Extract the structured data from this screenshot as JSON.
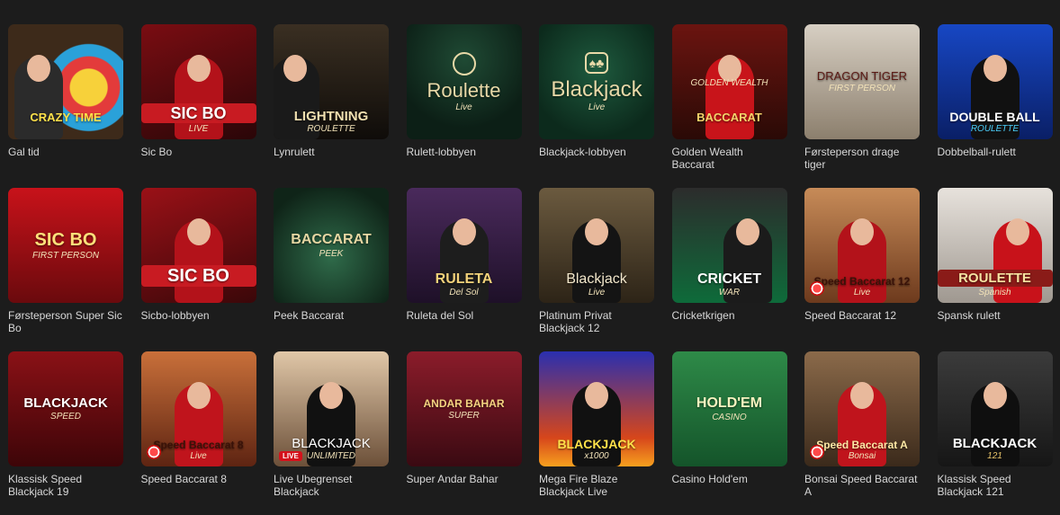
{
  "games": [
    {
      "name": "Gal tid",
      "logo": "CRAZY TIME",
      "sub": "",
      "style": "crazytime"
    },
    {
      "name": "Sic Bo",
      "logo": "SIC BO",
      "sub": "LIVE",
      "style": "sicbo"
    },
    {
      "name": "Lynrulett",
      "logo": "LIGHTNING",
      "sub": "ROULETTE",
      "style": "lightning"
    },
    {
      "name": "Rulett-lobbyen",
      "logo": "Roulette",
      "sub": "Live",
      "style": "roulette"
    },
    {
      "name": "Blackjack-lobbyen",
      "logo": "Blackjack",
      "sub": "Live",
      "style": "blackjack"
    },
    {
      "name": "Golden Wealth Baccarat",
      "logo": "BACCARAT",
      "sub": "GOLDEN WEALTH",
      "style": "golden"
    },
    {
      "name": "Førsteperson drage tiger",
      "logo": "DRAGON TIGER",
      "sub": "FIRST PERSON",
      "style": "dragon"
    },
    {
      "name": "Dobbelball-rulett",
      "logo": "DOUBLE BALL",
      "sub": "ROULETTE",
      "style": "doubleball"
    },
    {
      "name": "Førsteperson Super Sic Bo",
      "logo": "SIC BO",
      "sub": "FIRST PERSON",
      "style": "supersicbo"
    },
    {
      "name": "Sicbo-lobbyen",
      "logo": "SIC BO",
      "sub": "",
      "style": "sicbolobby"
    },
    {
      "name": "Peek Baccarat",
      "logo": "BACCARAT",
      "sub": "PEEK",
      "style": "peek"
    },
    {
      "name": "Ruleta del Sol",
      "logo": "RULETA",
      "sub": "Del Sol",
      "style": "ruleta"
    },
    {
      "name": "Platinum Privat Blackjack 12",
      "logo": "Blackjack",
      "sub": "Live",
      "style": "platinum"
    },
    {
      "name": "Cricketkrigen",
      "logo": "CRICKET",
      "sub": "WAR",
      "style": "cricket"
    },
    {
      "name": "Speed Baccarat 12",
      "logo": "Speed Baccarat 12",
      "sub": "Live",
      "style": "speedbac"
    },
    {
      "name": "Spansk rulett",
      "logo": "ROULETTE",
      "sub": "Spanish",
      "style": "spanish"
    },
    {
      "name": "Klassisk Speed Blackjack 19",
      "logo": "BLACKJACK",
      "sub": "SPEED",
      "style": "classic19"
    },
    {
      "name": "Speed Baccarat 8",
      "logo": "Speed Baccarat 8",
      "sub": "Live",
      "style": "speedbac8"
    },
    {
      "name": "Live Ubegrenset Blackjack",
      "logo": "BLACKJACK",
      "sub": "UNLIMITED",
      "style": "unlimited"
    },
    {
      "name": "Super Andar Bahar",
      "logo": "ANDAR BAHAR",
      "sub": "SUPER",
      "style": "andar"
    },
    {
      "name": "Mega Fire Blaze Blackjack Live",
      "logo": "BLACKJACK",
      "sub": "x1000",
      "style": "megafire"
    },
    {
      "name": "Casino Hold'em",
      "logo": "HOLD'EM",
      "sub": "CASINO",
      "style": "holdem"
    },
    {
      "name": "Bonsai Speed Baccarat A",
      "logo": "Speed Baccarat A",
      "sub": "Bonsai",
      "style": "bonsai"
    },
    {
      "name": "Klassisk Speed Blackjack 121",
      "logo": "BLACKJACK",
      "sub": "121",
      "style": "classic121"
    }
  ],
  "badges": {
    "live": "LIVE"
  }
}
